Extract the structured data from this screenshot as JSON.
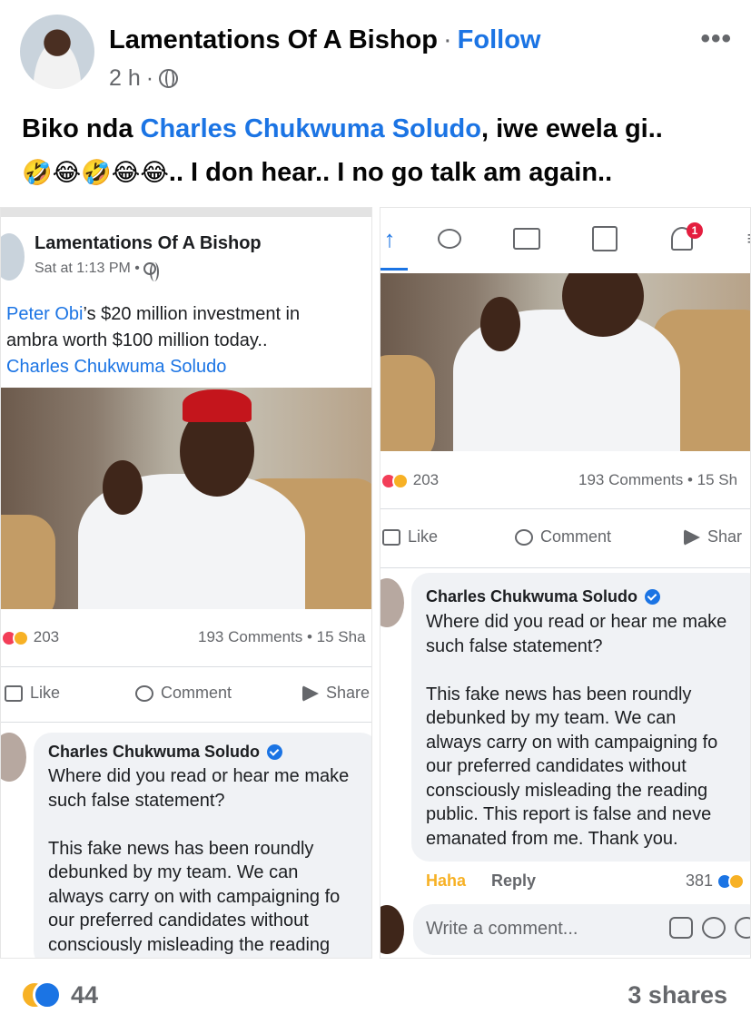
{
  "post": {
    "author": "Lamentations Of A Bishop",
    "follow_label": "Follow",
    "time": "2 h",
    "caption_before": "Biko nda ",
    "caption_link": "Charles Chukwuma Soludo",
    "caption_after": ", iwe ewela gi..",
    "caption_emojis": "🤣😂🤣😂😂",
    "caption_line2": ".. I don hear.. I no go talk am again..",
    "reaction_count": "44",
    "shares": "3 shares"
  },
  "left_shot": {
    "author": "Lamentations Of A Bishop",
    "meta": "Sat at 1:13 PM •",
    "text_line1_link": "Peter Obi",
    "text_line1_rest": "’s $20 million investment in",
    "text_line2": "ambra worth $100 million today..",
    "text_line3_link": "Charles Chukwuma Soludo",
    "reaction_count": "203",
    "comments_shares": "193 Comments • 15 Sha",
    "like_label": "Like",
    "comment_label": "Comment",
    "share_label": "Share",
    "comment_author": "Charles Chukwuma Soludo",
    "comment_text": "Where did you read or hear me make\nsuch false statement?\n\nThis fake news has been roundly\ndebunked by my team. We can\nalways carry on with campaigning fo\nour preferred candidates without\nconsciously misleading the reading"
  },
  "right_shot": {
    "notification_count": "1",
    "reaction_count": "203",
    "comments_shares": "193 Comments • 15 Sh",
    "like_label": "Like",
    "comment_label": "Comment",
    "share_label": "Shar",
    "comment_author": "Charles Chukwuma Soludo",
    "comment_text": "Where did you read or hear me make\nsuch false statement?\n\nThis fake news has been roundly\ndebunked by my team. We can\nalways carry on with campaigning fo\nour preferred candidates without\nconsciously misleading the reading\npublic. This report is false and neve\nemanated from me. Thank you.",
    "haha_label": "Haha",
    "reply_label": "Reply",
    "reply_reactions": "381",
    "write_placeholder": "Write a comment..."
  }
}
